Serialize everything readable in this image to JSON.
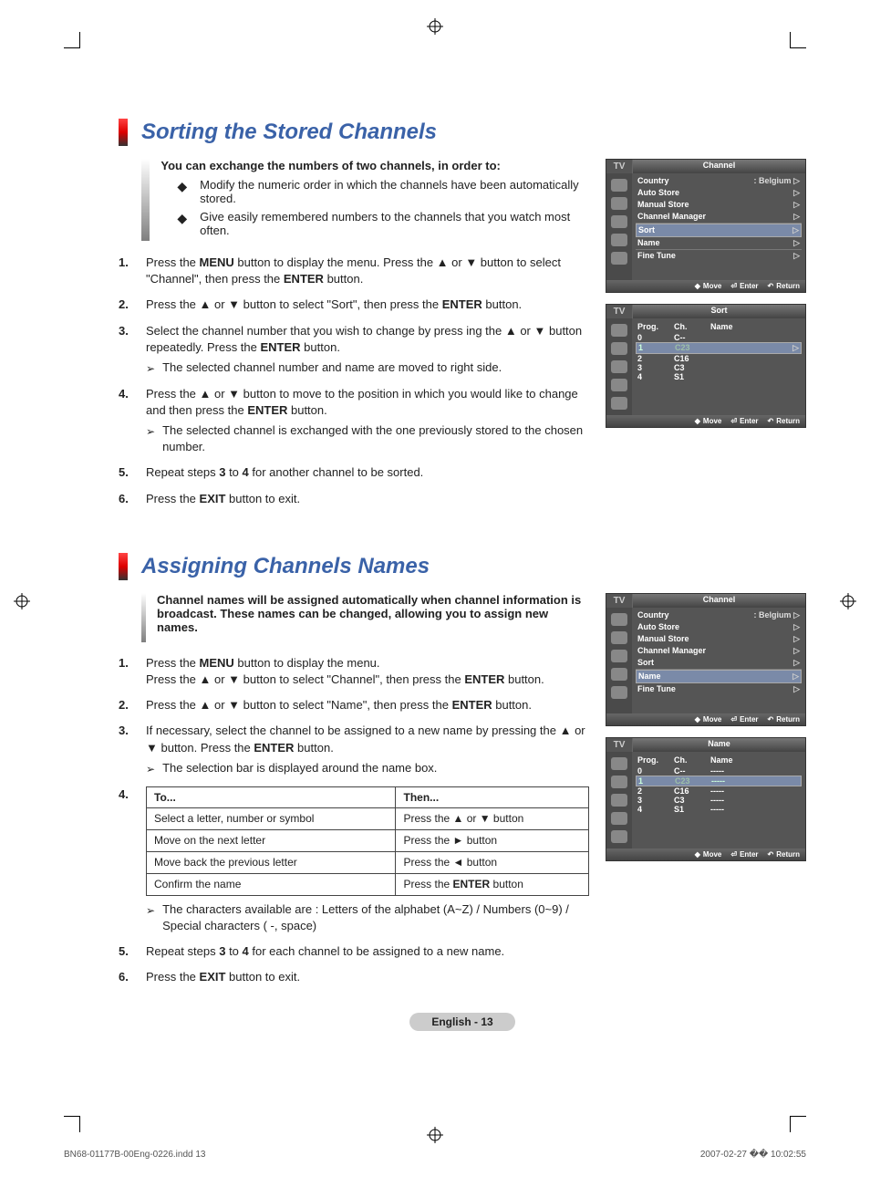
{
  "section1": {
    "title": "Sorting the Stored Channels",
    "intro_lead": "You can exchange the numbers of two channels, in order to:",
    "bullets": [
      "Modify the numeric order in which the channels have been automatically stored.",
      "Give easily remembered numbers to the channels that you watch most often."
    ],
    "steps": [
      {
        "n": "1.",
        "text_a": "Press the ",
        "b1": "MENU",
        "text_b": " button to display the menu. Press the ▲ or ▼ button to select \"Channel\", then press the ",
        "b2": "ENTER",
        "text_c": " button."
      },
      {
        "n": "2.",
        "text_a": "Press the ▲ or ▼ button to select \"Sort\", then press the ",
        "b1": "ENTER",
        "text_b": " button."
      },
      {
        "n": "3.",
        "text_a": "Select the channel number that you wish to change by press ing the ▲ or ▼ button repeatedly. Press the ",
        "b1": "ENTER",
        "text_b": " button.",
        "note": "The selected channel number and name are moved to right side."
      },
      {
        "n": "4.",
        "text_a": "Press the ▲ or ▼ button to move to the position in which you would like to change and then press the ",
        "b1": "ENTER",
        "text_b": " button.",
        "note": "The selected channel is exchanged with the one previously stored to the chosen number."
      },
      {
        "n": "5.",
        "text_a": "Repeat steps ",
        "b1": "3",
        "text_b": " to ",
        "b2": "4",
        "text_c": " for another channel to be sorted."
      },
      {
        "n": "6.",
        "text_a": "Press the ",
        "b1": "EXIT",
        "text_b": " button to exit."
      }
    ]
  },
  "section2": {
    "title": "Assigning Channels Names",
    "intro_lead": "Channel names will be assigned automatically when channel information is broadcast. These names can be changed, allowing you to assign new names.",
    "steps": [
      {
        "n": "1.",
        "text_a": "Press the ",
        "b1": "MENU",
        "text_b": " button to display the menu.\nPress the ▲ or ▼ button to select \"Channel\", then press the ",
        "b2": "ENTER",
        "text_c": " button."
      },
      {
        "n": "2.",
        "text_a": "Press the ▲ or ▼ button to select \"Name\", then press the ",
        "b1": "ENTER",
        "text_b": " button."
      },
      {
        "n": "3.",
        "text_a": "If necessary, select the channel to be assigned to a new name by pressing the ▲ or ▼ button. Press the ",
        "b1": "ENTER",
        "text_b": " button.",
        "note": "The selection bar is displayed around the name box."
      }
    ],
    "table": {
      "h1": "To...",
      "h2": "Then...",
      "rows": [
        {
          "a": "Select a letter, number or symbol",
          "b": "Press the ▲ or ▼ button"
        },
        {
          "a": "Move on the next letter",
          "b": "Press the ► button"
        },
        {
          "a": "Move back the previous letter",
          "b": "Press the ◄ button"
        },
        {
          "a": "Confirm the name",
          "b_a": "Press the ",
          "b_b": "ENTER",
          "b_c": " button"
        }
      ]
    },
    "step4_num": "4.",
    "after_table_note": "The characters available are : Letters of the alphabet (A~Z) / Numbers (0~9) / Special characters ( -, space)",
    "step5": {
      "n": "5.",
      "text_a": "Repeat steps ",
      "b1": "3",
      "text_b": " to ",
      "b2": "4",
      "text_c": " for each channel to be assigned to a new name."
    },
    "step6": {
      "n": "6.",
      "text_a": "Press the ",
      "b1": "EXIT",
      "text_b": " button to exit."
    }
  },
  "osd": {
    "tv_label": "TV",
    "channel_title": "Channel",
    "sort_title": "Sort",
    "name_title": "Name",
    "menu_items": {
      "country": "Country",
      "country_val": ": Belgium",
      "auto_store": "Auto Store",
      "manual_store": "Manual Store",
      "channel_manager": "Channel Manager",
      "sort": "Sort",
      "name": "Name",
      "fine_tune": "Fine Tune"
    },
    "cols": {
      "prog": "Prog.",
      "ch": "Ch.",
      "name": "Name"
    },
    "sort_rows": [
      {
        "p": "0",
        "c": "C--",
        "n": ""
      },
      {
        "p": "1",
        "c": "C23",
        "n": "",
        "sel": true
      },
      {
        "p": "2",
        "c": "C16",
        "n": ""
      },
      {
        "p": "3",
        "c": "C3",
        "n": ""
      },
      {
        "p": "4",
        "c": "S1",
        "n": ""
      }
    ],
    "name_rows": [
      {
        "p": "0",
        "c": "C--",
        "n": "-----"
      },
      {
        "p": "1",
        "c": "C23",
        "n": "-----",
        "sel": true
      },
      {
        "p": "2",
        "c": "C16",
        "n": "-----"
      },
      {
        "p": "3",
        "c": "C3",
        "n": "-----"
      },
      {
        "p": "4",
        "c": "S1",
        "n": "-----"
      }
    ],
    "footer": {
      "move": "Move",
      "enter": "Enter",
      "return": "Return"
    }
  },
  "page_label": "English - 13",
  "footer": {
    "file": "BN68-01177B-00Eng-0226.indd   13",
    "ts": "2007-02-27   �� 10:02:55"
  }
}
